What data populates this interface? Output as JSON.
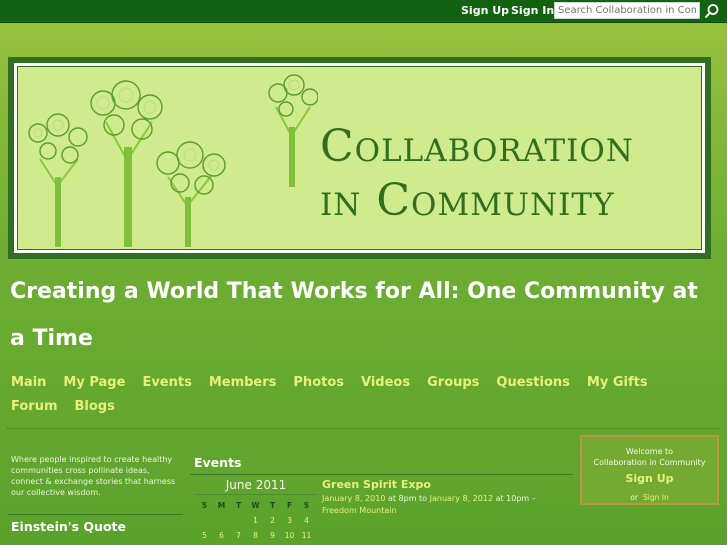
{
  "topbar": {
    "signup": "Sign Up",
    "signin": "Sign In",
    "search_placeholder": "Search Collaboration in Community",
    "search_icon": "search-icon"
  },
  "banner": {
    "line1": "Collaboration",
    "line2": "in Community",
    "colors": {
      "frame": "#2f6f1f",
      "background": "#cfeb8d",
      "text": "#2f6f1f"
    }
  },
  "tagline": "Creating a World That Works for All: One Community at a Time",
  "nav": [
    "Main",
    "My Page",
    "Events",
    "Members",
    "Photos",
    "Videos",
    "Groups",
    "Questions",
    "My Gifts",
    "Forum",
    "Blogs"
  ],
  "left": {
    "description": "Where people inspired to create healthy communities cross pollinate ideas, connect & exchange stories that harness our collective wisdom.",
    "heading": "Einstein's Quote"
  },
  "events": {
    "heading": "Events",
    "calendar": {
      "month": "June 2011",
      "day_headers": [
        "S",
        "M",
        "T",
        "W",
        "T",
        "F",
        "S"
      ],
      "days": [
        "",
        "",
        "",
        "1",
        "2",
        "3",
        "4",
        "5",
        "6",
        "7",
        "8",
        "9",
        "10",
        "11"
      ]
    },
    "item": {
      "title": "Green Spirit Expo",
      "start": "January 8, 2010",
      "start_time": "at 8pm to",
      "end": "January 8, 2012",
      "end_time": "at 10pm –",
      "location": "Freedom Mountain"
    }
  },
  "welcome": {
    "line1": "Welcome to",
    "line2": "Collaboration in Community",
    "signup": "Sign Up",
    "or": "or",
    "signin": "Sign In"
  },
  "colors": {
    "topbar": "#136212",
    "nav_link": "#e8f07a",
    "heading": "#ffffff",
    "welcome_border": "#b9983f"
  }
}
